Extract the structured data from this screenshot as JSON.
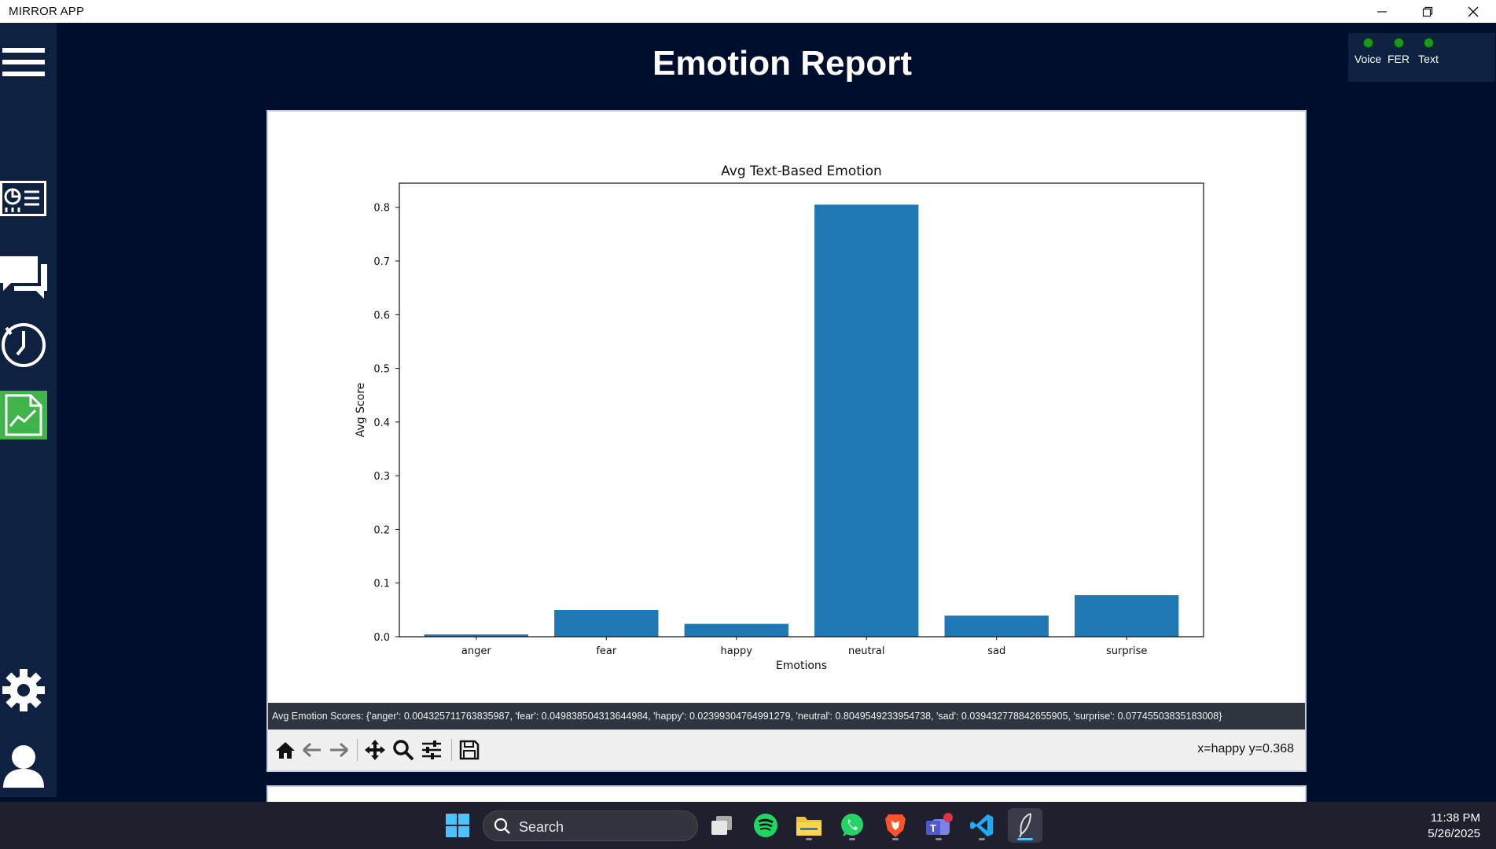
{
  "window": {
    "title": "MIRROR APP"
  },
  "header": {
    "title": "Emotion Report"
  },
  "status": [
    {
      "label": "Voice",
      "color": "#1a9a1a"
    },
    {
      "label": "FER",
      "color": "#1a9a1a"
    },
    {
      "label": "Text",
      "color": "#1a9a1a"
    }
  ],
  "sidebar": {
    "items": [
      {
        "icon": "menu-icon"
      },
      {
        "icon": "dashboard-icon"
      },
      {
        "icon": "chat-icon"
      },
      {
        "icon": "history-clock-icon"
      },
      {
        "icon": "report-chart-icon",
        "active": true
      },
      {
        "icon": "gear-icon"
      },
      {
        "icon": "user-icon"
      }
    ]
  },
  "chart_data": {
    "type": "bar",
    "title": "Avg Text-Based Emotion",
    "xlabel": "Emotions",
    "ylabel": "Avg Score",
    "categories": [
      "anger",
      "fear",
      "happy",
      "neutral",
      "sad",
      "surprise"
    ],
    "values": [
      0.004325711763835987,
      0.049838504313644984,
      0.02399304764991279,
      0.8049549233954738,
      0.039432778842655905,
      0.07745503835183008
    ],
    "ylim": [
      0,
      0.845
    ],
    "yticks": [
      "0.0",
      "0.1",
      "0.2",
      "0.3",
      "0.4",
      "0.5",
      "0.6",
      "0.7",
      "0.8"
    ],
    "bar_color": "#1f77b4",
    "grid": false
  },
  "scores_text": "Avg Emotion Scores: {'anger': 0.004325711763835987, 'fear': 0.049838504313644984, 'happy': 0.02399304764991279, 'neutral': 0.8049549233954738, 'sad': 0.039432778842655905, 'surprise': 0.07745503835183008}",
  "toolbar": {
    "buttons": [
      "home-icon",
      "back-arrow-icon",
      "forward-arrow-icon",
      "pan-icon",
      "zoom-icon",
      "configure-subplots-icon",
      "save-icon"
    ],
    "coords": "x=happy y=0.368"
  },
  "taskbar": {
    "search_label": "Search",
    "time": "11:38 PM",
    "date": "5/26/2025"
  }
}
